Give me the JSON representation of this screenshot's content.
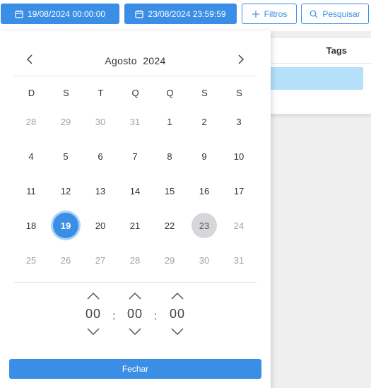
{
  "toolbar": {
    "start_date": "19/08/2024 00:00:00",
    "end_date": "23/08/2024 23:59:59",
    "filters_label": "Filtros",
    "search_label": "Pesquisar"
  },
  "table": {
    "header_tags": "Tags"
  },
  "calendar": {
    "month": "Agosto",
    "year": "2024",
    "weekdays": [
      "D",
      "S",
      "T",
      "Q",
      "Q",
      "S",
      "S"
    ],
    "weeks": [
      [
        {
          "d": "28",
          "m": true
        },
        {
          "d": "29",
          "m": true
        },
        {
          "d": "30",
          "m": true
        },
        {
          "d": "31",
          "m": true
        },
        {
          "d": "1"
        },
        {
          "d": "2"
        },
        {
          "d": "3"
        }
      ],
      [
        {
          "d": "4"
        },
        {
          "d": "5"
        },
        {
          "d": "6"
        },
        {
          "d": "7"
        },
        {
          "d": "8"
        },
        {
          "d": "9"
        },
        {
          "d": "10"
        }
      ],
      [
        {
          "d": "11"
        },
        {
          "d": "12"
        },
        {
          "d": "13"
        },
        {
          "d": "14"
        },
        {
          "d": "15"
        },
        {
          "d": "16"
        },
        {
          "d": "17"
        }
      ],
      [
        {
          "d": "18"
        },
        {
          "d": "19",
          "sel": true
        },
        {
          "d": "20"
        },
        {
          "d": "21"
        },
        {
          "d": "22"
        },
        {
          "d": "23",
          "end": true
        },
        {
          "d": "24",
          "m": true
        }
      ],
      [
        {
          "d": "25",
          "m": true
        },
        {
          "d": "26",
          "m": true
        },
        {
          "d": "27",
          "m": true
        },
        {
          "d": "28",
          "m": true
        },
        {
          "d": "29",
          "m": true
        },
        {
          "d": "30",
          "m": true
        },
        {
          "d": "31",
          "m": true
        }
      ]
    ]
  },
  "time": {
    "hours": "00",
    "minutes": "00",
    "seconds": "00",
    "separator": ":"
  },
  "close_label": "Fechar",
  "colors": {
    "accent": "#3a8ee6",
    "selected_ring": "#a9d3f7",
    "range_end": "#d5d7da",
    "row_highlight": "#b4e0fa"
  }
}
